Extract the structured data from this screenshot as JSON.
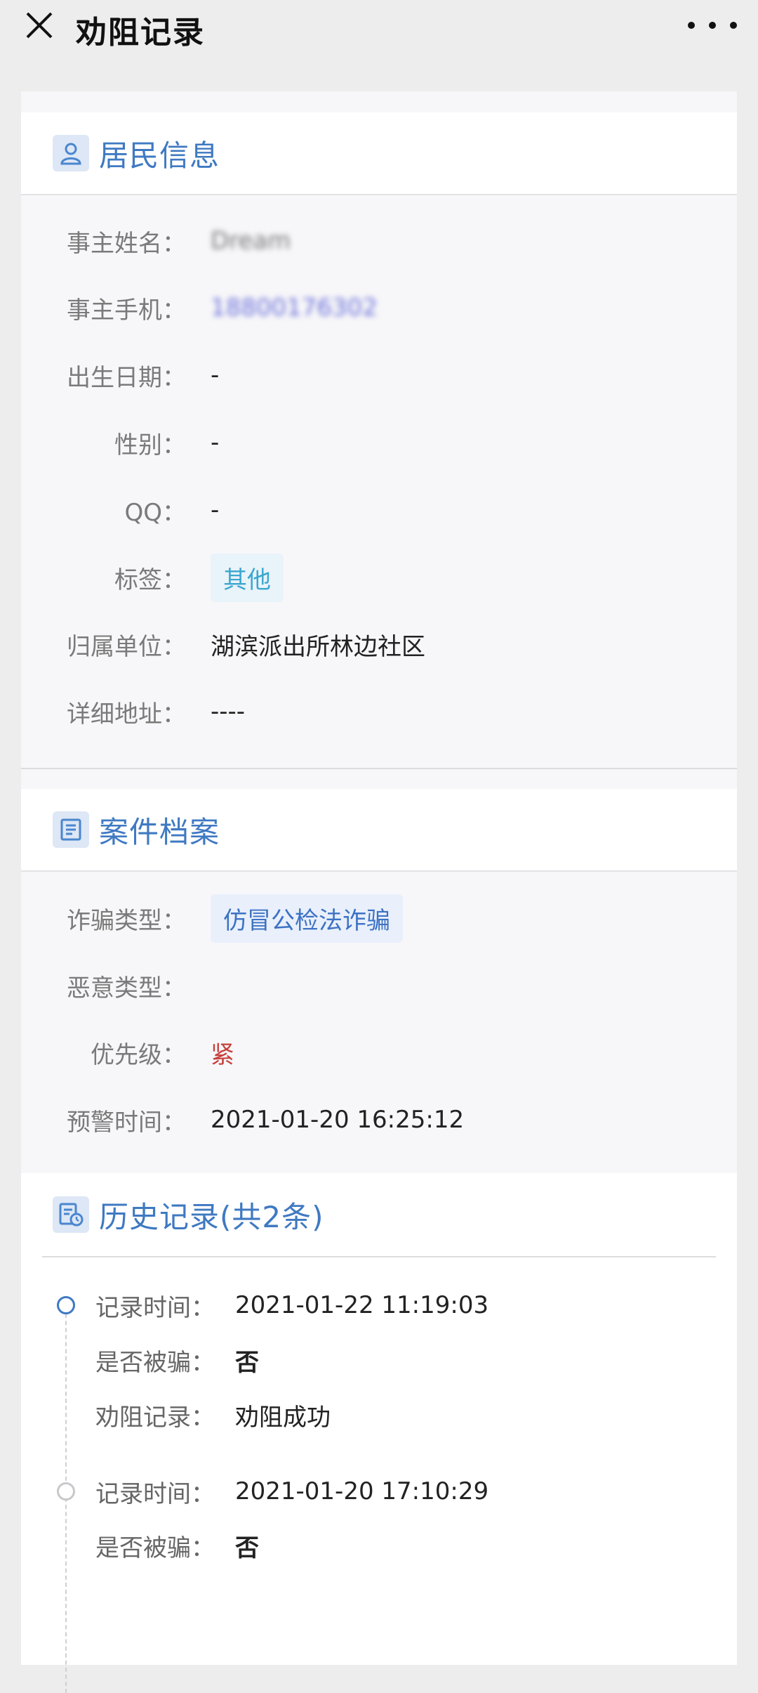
{
  "header": {
    "title": "劝阻记录",
    "close_icon": "close-icon",
    "more_icon": "more-icon"
  },
  "resident": {
    "title": "居民信息",
    "icon": "person-icon",
    "fields": {
      "name_label": "事主姓名：",
      "name_value": "Dream",
      "phone_label": "事主手机：",
      "phone_value": "18800176302",
      "birth_label": "出生日期：",
      "birth_value": "-",
      "gender_label": "性别：",
      "gender_value": "-",
      "qq_label": "QQ：",
      "qq_value": "-",
      "tag_label": "标签：",
      "tag_value": "其他",
      "unit_label": "归属单位：",
      "unit_value": "湖滨派出所林边社区",
      "address_label": "详细地址：",
      "address_value": "----"
    }
  },
  "case": {
    "title": "案件档案",
    "icon": "document-icon",
    "fields": {
      "fraud_type_label": "诈骗类型：",
      "fraud_type_value": "仿冒公检法诈骗",
      "malicious_type_label": "恶意类型：",
      "malicious_type_value": "",
      "priority_label": "优先级：",
      "priority_value": "紧",
      "alert_time_label": "预警时间：",
      "alert_time_value": "2021-01-20 16:25:12"
    }
  },
  "history": {
    "title": "历史记录(共2条)",
    "icon": "history-icon",
    "records": [
      {
        "time_label": "记录时间：",
        "time_value": "2021-01-22 11:19:03",
        "scammed_label": "是否被骗：",
        "scammed_value": "否",
        "record_label": "劝阻记录：",
        "record_value": "劝阻成功"
      },
      {
        "time_label": "记录时间：",
        "time_value": "2021-01-20 17:10:29",
        "scammed_label": "是否被骗：",
        "scammed_value": "否"
      }
    ]
  },
  "colors": {
    "accent": "#3f79c2",
    "urgent": "#c73f3a",
    "tag_cyan": "#3aa7cf"
  }
}
